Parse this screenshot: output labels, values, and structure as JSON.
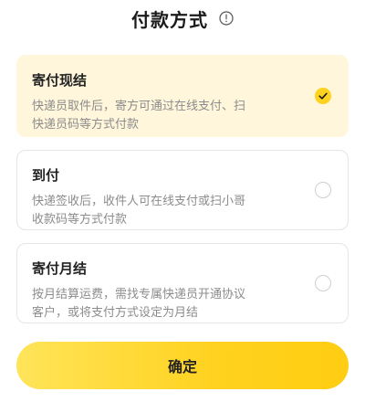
{
  "header": {
    "title": "付款方式"
  },
  "options": [
    {
      "title": "寄付现结",
      "desc_line1": "快递员取件后，寄方可通过在线支付、扫",
      "desc_line2": "快递员码等方式付款",
      "selected": true
    },
    {
      "title": "到付",
      "desc_line1": "快递签收后，收件人可在线支付或扫小哥",
      "desc_line2": "收款码等方式付款",
      "selected": false
    },
    {
      "title": "寄付月结",
      "desc_line1": "按月结算运费，需找专属快递员开通协议",
      "desc_line2": "客户，或将支付方式设定为月结",
      "selected": false
    }
  ],
  "confirm": {
    "label": "确定"
  },
  "colors": {
    "accent": "#ffd21f",
    "selected_bg": "#fff6db",
    "muted_text": "#8c8c8c"
  },
  "icons": {
    "info": "info-icon",
    "check": "check-icon"
  }
}
